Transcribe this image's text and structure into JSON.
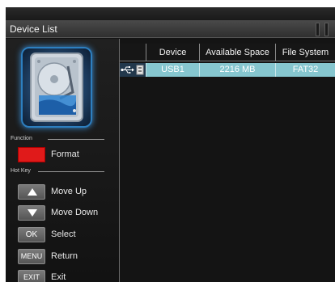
{
  "window": {
    "title": "Device List"
  },
  "left_panel": {
    "function_label": "Function",
    "hotkey_label": "Hot Key",
    "function_key": {
      "action": "Format",
      "color": "#e01a1a"
    },
    "hotkeys": [
      {
        "key_icon": "arrow-up-icon",
        "key_text": "",
        "action": "Move Up"
      },
      {
        "key_icon": "arrow-down-icon",
        "key_text": "",
        "action": "Move Down"
      },
      {
        "key_icon": "",
        "key_text": "OK",
        "action": "Select"
      },
      {
        "key_icon": "",
        "key_text": "MENU",
        "action": "Return"
      },
      {
        "key_icon": "",
        "key_text": "EXIT",
        "action": "Exit"
      }
    ],
    "device_icon": "hard-drive-icon"
  },
  "table": {
    "columns": [
      "Device",
      "Available Space",
      "File System"
    ],
    "rows": [
      {
        "type_icon": "usb-icon",
        "device": "USB1",
        "available_space": "2216 MB",
        "file_system": "FAT32"
      }
    ],
    "selected_row_color": "#86c6cf"
  }
}
